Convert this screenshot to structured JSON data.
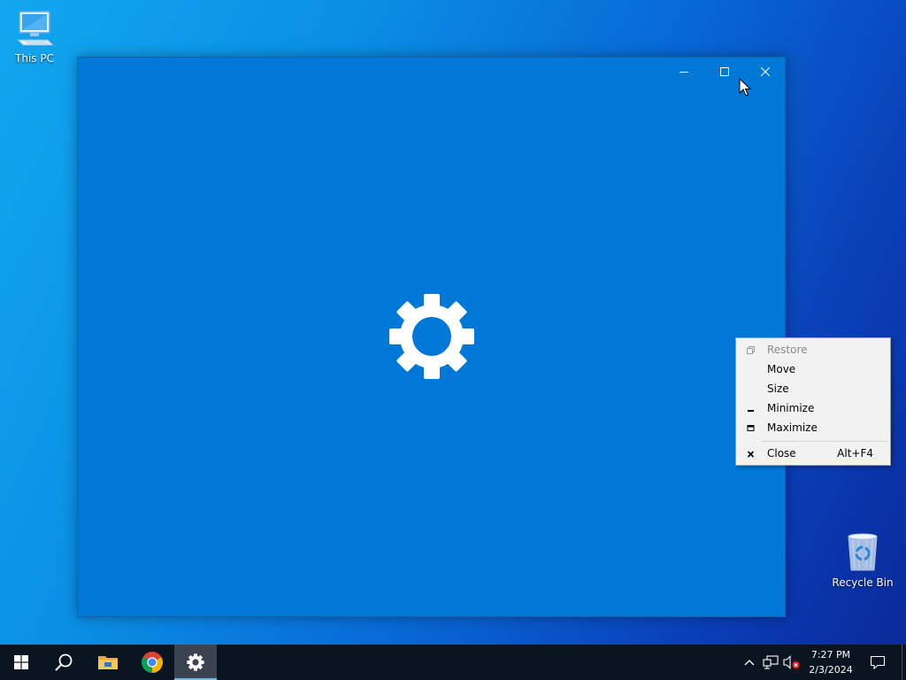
{
  "desktop": {
    "icons": [
      {
        "label": "This PC"
      },
      {
        "label": "Recycle Bin"
      }
    ]
  },
  "window": {
    "app": "Settings",
    "caption_buttons": [
      "minimize",
      "maximize",
      "close"
    ],
    "splash_icon": "gear-icon",
    "background_color": "#0078d7"
  },
  "system_menu": {
    "items": [
      {
        "label": "Restore",
        "icon": "restore-icon",
        "enabled": false,
        "accel": ""
      },
      {
        "label": "Move",
        "icon": "",
        "enabled": true,
        "accel": ""
      },
      {
        "label": "Size",
        "icon": "",
        "enabled": true,
        "accel": ""
      },
      {
        "label": "Minimize",
        "icon": "minimize-icon",
        "enabled": true,
        "accel": ""
      },
      {
        "label": "Maximize",
        "icon": "maximize-icon",
        "enabled": true,
        "accel": ""
      },
      {
        "label": "Close",
        "icon": "close-icon",
        "enabled": true,
        "accel": "Alt+F4"
      }
    ]
  },
  "taskbar": {
    "pinned": [
      "windows-start-icon",
      "search-icon",
      "file-explorer-icon",
      "chrome-icon",
      "settings-icon"
    ],
    "active_app": "Settings",
    "clock": {
      "time": "7:27 PM",
      "date": "2/3/2024"
    },
    "tray": [
      "chevron-up-icon",
      "network-icon",
      "volume-muted-icon",
      "notification-icon"
    ]
  }
}
